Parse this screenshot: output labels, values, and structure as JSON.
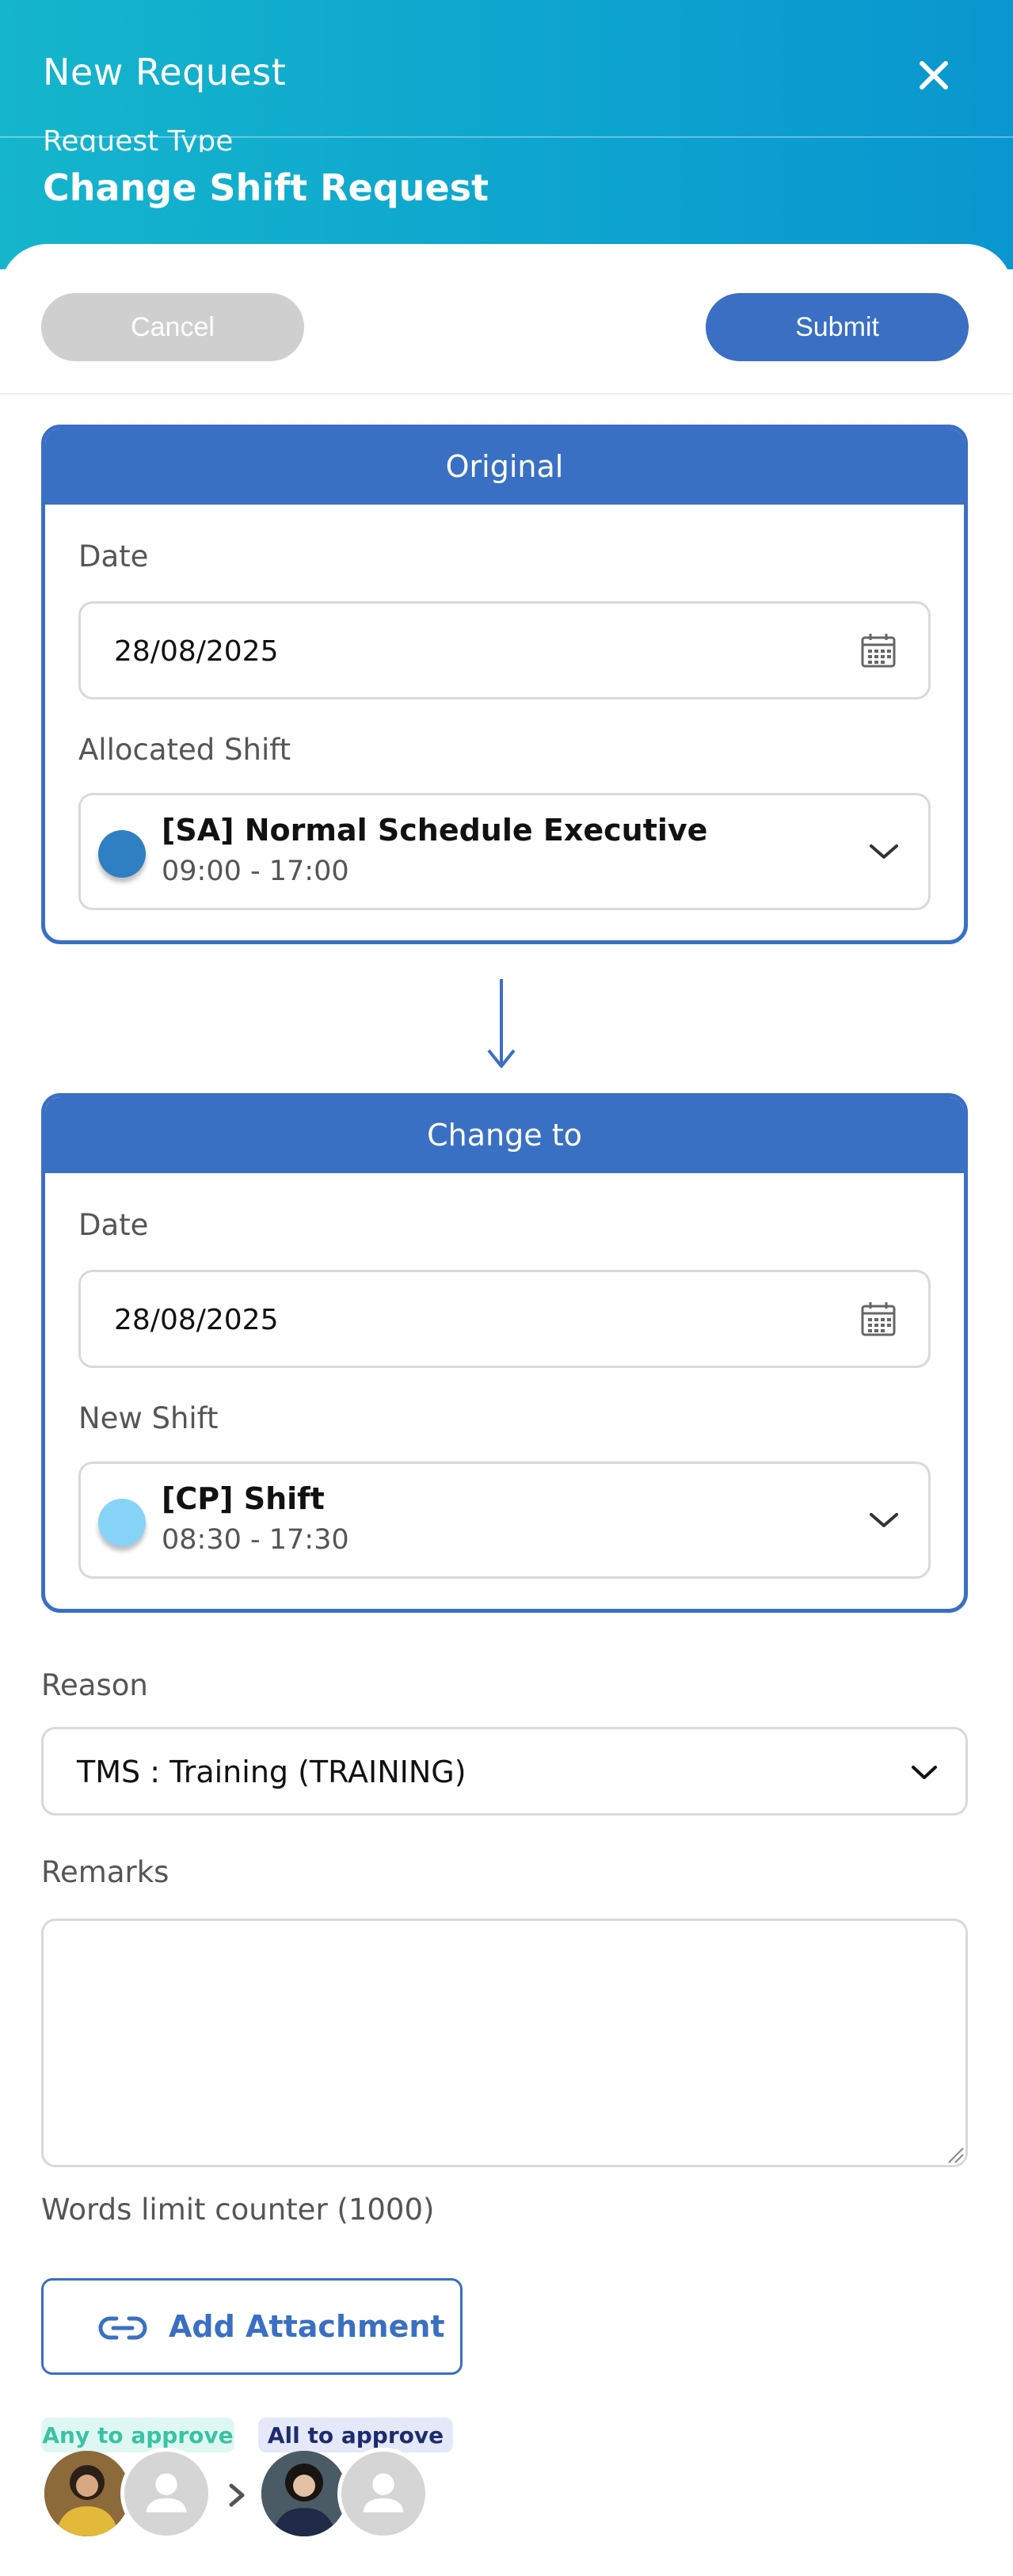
{
  "header": {
    "title": "New Request",
    "request_type_label": "Request Type",
    "request_type_value": "Change Shift Request"
  },
  "toolbar": {
    "cancel_label": "Cancel",
    "submit_label": "Submit"
  },
  "original": {
    "heading": "Original",
    "date_label": "Date",
    "date_value": "28/08/2025",
    "shift_label": "Allocated Shift",
    "shift_name": "[SA] Normal Schedule Executive",
    "shift_time": "09:00 - 17:00",
    "shift_color": "#2f7fc3"
  },
  "change_to": {
    "heading": "Change to",
    "date_label": "Date",
    "date_value": "28/08/2025",
    "shift_label": "New Shift",
    "shift_name": "[CP] Shift",
    "shift_time": "08:30 - 17:30",
    "shift_color": "#86d3f7"
  },
  "reason": {
    "label": "Reason",
    "value": "TMS : Training (TRAINING)"
  },
  "remarks": {
    "label": "Remarks",
    "value": "",
    "counter": "Words limit counter (1000)"
  },
  "attachment": {
    "label": "Add Attachment"
  },
  "approvals": {
    "any_label": "Any to approve",
    "all_label": "All to approve"
  },
  "colors": {
    "accent": "#3a6fc4",
    "header_gradient_start": "#15b5cc",
    "header_gradient_end": "#0a96cf"
  },
  "icons": [
    "close-icon",
    "calendar-icon",
    "chevron-down-icon",
    "arrow-down-icon",
    "link-icon",
    "chevron-right-icon",
    "user-placeholder-icon"
  ]
}
